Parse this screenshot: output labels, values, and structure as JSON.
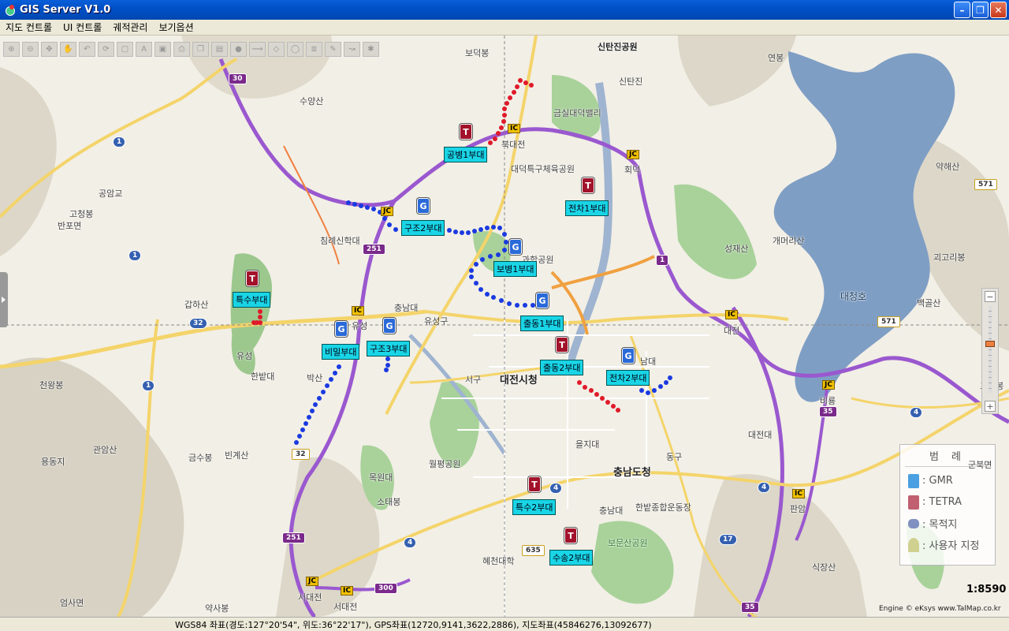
{
  "window": {
    "title": "GIS Server V1.0"
  },
  "menu": [
    "지도 컨트롤",
    "UI 컨트롤",
    "궤적관리",
    "보기옵션"
  ],
  "places": [
    {
      "n": "보덕봉"
    },
    {
      "n": "신탄진공원"
    },
    {
      "n": "신탄진"
    },
    {
      "n": "연봉"
    },
    {
      "n": "수양산"
    },
    {
      "n": "금실대덕밸리"
    },
    {
      "n": "북대전"
    },
    {
      "n": "대덕특구체육공원"
    },
    {
      "n": "회덕"
    },
    {
      "n": "약해산"
    },
    {
      "n": "공암교"
    },
    {
      "n": "고청봉"
    },
    {
      "n": "반포면"
    },
    {
      "n": "침례신학대"
    },
    {
      "n": "과학공원"
    },
    {
      "n": "성재산"
    },
    {
      "n": "개머리산"
    },
    {
      "n": "괴고리봉"
    },
    {
      "n": "대청호"
    },
    {
      "n": "백골산"
    },
    {
      "n": "갑하산"
    },
    {
      "n": "충남대"
    },
    {
      "n": "유성구"
    },
    {
      "n": "유성"
    },
    {
      "n": "대전"
    },
    {
      "n": "고리봉"
    },
    {
      "n": "유성"
    },
    {
      "n": "한밭대"
    },
    {
      "n": "박산"
    },
    {
      "n": "서구"
    },
    {
      "n": "대전시청"
    },
    {
      "n": "남대"
    },
    {
      "n": "천왕봉"
    },
    {
      "n": "비룡"
    },
    {
      "n": "대전대"
    },
    {
      "n": "을지대"
    },
    {
      "n": "관암산"
    },
    {
      "n": "금수봉"
    },
    {
      "n": "빈계산"
    },
    {
      "n": "월평공원"
    },
    {
      "n": "동구"
    },
    {
      "n": "충남도청"
    },
    {
      "n": "군북면"
    },
    {
      "n": "용동지"
    },
    {
      "n": "목원대"
    },
    {
      "n": "소태봉"
    },
    {
      "n": "충남대"
    },
    {
      "n": "한밭종합운동장"
    },
    {
      "n": "판암"
    },
    {
      "n": "보문산공원"
    },
    {
      "n": "혜천대학"
    },
    {
      "n": "식장산"
    },
    {
      "n": "서대전"
    },
    {
      "n": "엄사면"
    },
    {
      "n": "약사봉"
    },
    {
      "n": "서대전"
    }
  ],
  "units": [
    {
      "label": "공병1부대",
      "type": "TETRA"
    },
    {
      "label": "전차1부대",
      "type": "TETRA"
    },
    {
      "label": "구조2부대",
      "type": "GMR"
    },
    {
      "label": "보병1부대",
      "type": "GMR"
    },
    {
      "label": "특수부대",
      "type": "TETRA"
    },
    {
      "label": "출동1부대",
      "type": "GMR"
    },
    {
      "label": "비밀부대",
      "type": "GMR"
    },
    {
      "label": "구조3부대",
      "type": "GMR"
    },
    {
      "label": "출동2부대",
      "type": "TETRA"
    },
    {
      "label": "전차2부대",
      "type": "GMR"
    },
    {
      "label": "특수2부대",
      "type": "TETRA"
    },
    {
      "label": "수송2부대",
      "type": "TETRA"
    }
  ],
  "marker_letters": {
    "tetra": "T",
    "gmr": "G"
  },
  "road_shields": [
    "30",
    "1",
    "1",
    "32",
    "251",
    "1",
    "32",
    "251",
    "300",
    "4",
    "635",
    "4",
    "4",
    "17",
    "35",
    "35",
    "4",
    "571",
    "571",
    "1"
  ],
  "interchange_labels": [
    "IC",
    "JC",
    "JC",
    "IC",
    "IC",
    "JC",
    "IC",
    "JC",
    "IC",
    "IC",
    "IC",
    "JC"
  ],
  "legend": {
    "title": "범 례",
    "items": [
      {
        "label": ": GMR",
        "color": "#4aa0e0"
      },
      {
        "label": ": TETRA",
        "color": "#c06070"
      },
      {
        "label": ": 목적지",
        "color": "#8090c0"
      },
      {
        "label": ": 사용자 지정",
        "color": "#d0d090"
      }
    ]
  },
  "scale": "1:8590",
  "engine": "Engine © eKsys www.TalMap.co.kr",
  "status": "WGS84 좌표(경도:127°20'54\", 위도:36°22'17\"), GPS좌표(12720,9141,3622,2886), 지도좌표(45846276,13092677)",
  "colors": {
    "gmr": "#2a6ad8",
    "tetra": "#a2122a",
    "label_bg": "#19d5e6",
    "track_blue": "#1a3ae0",
    "track_red": "#e01a2a"
  }
}
